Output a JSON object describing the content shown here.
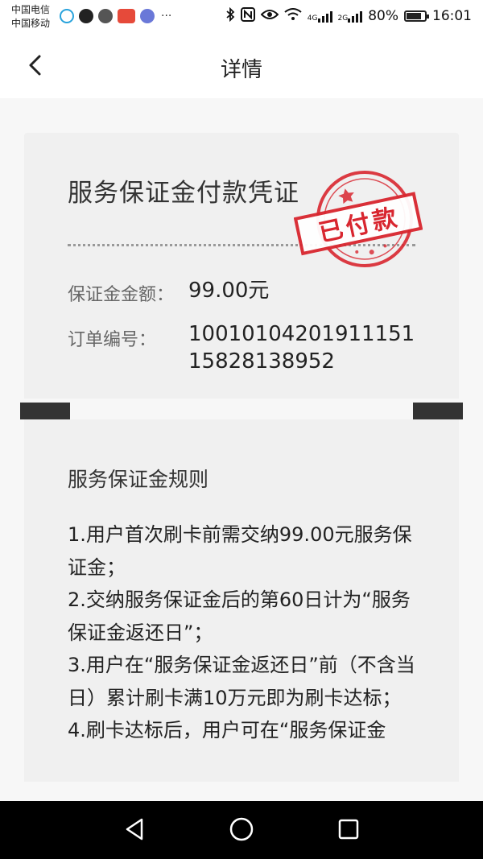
{
  "status_bar": {
    "carrier_1": "中国电信",
    "carrier_2": "中国移动",
    "more": "···",
    "network_1": "4G",
    "network_2": "2G",
    "battery_text": "80%",
    "battery_level": 0.8,
    "time": "16:01"
  },
  "header": {
    "title": "详情"
  },
  "voucher": {
    "title": "服务保证金付款凭证",
    "stamp_text": "已付款",
    "amount_label": "保证金金额：",
    "amount_value": "99.00元",
    "order_label": "订单编号：",
    "order_value": "1001010420191115115828138952"
  },
  "rules": {
    "title": "服务保证金规则",
    "items": [
      "1.用户首次刷卡前需交纳99.00元服务保证金；",
      "2.交纳服务保证金后的第60日计为“服务保证金返还日”；",
      "3.用户在“服务保证金返还日”前（不含当日）累计刷卡满10万元即为刷卡达标；",
      "4.刷卡达标后，用户可在“服务保证金"
    ]
  },
  "colors": {
    "stamp_red": "#d8262f",
    "card_bg": "#f0f0f0",
    "tab_dark": "#333333"
  }
}
